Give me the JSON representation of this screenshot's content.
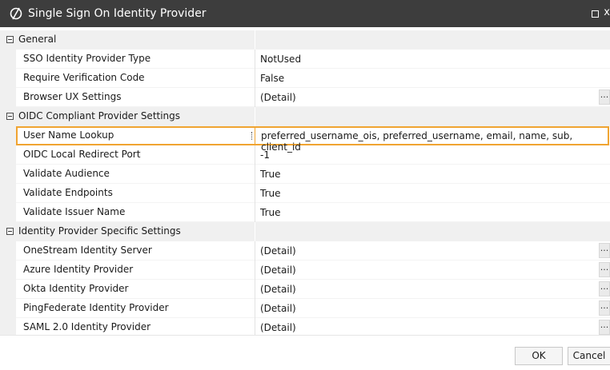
{
  "window": {
    "title": "Single Sign On Identity Provider",
    "close_glyph": "x"
  },
  "categories": [
    {
      "label": "General",
      "props": [
        {
          "name": "SSO Identity Provider Type",
          "value": "NotUsed",
          "ellipsis": false
        },
        {
          "name": "Require Verification Code",
          "value": "False",
          "ellipsis": false
        },
        {
          "name": "Browser UX Settings",
          "value": "(Detail)",
          "ellipsis": true
        }
      ]
    },
    {
      "label": "OIDC Compliant Provider Settings",
      "props": [
        {
          "name": "User Name Lookup",
          "value": "preferred_username_ois, preferred_username, email, name, sub, client_id",
          "ellipsis": false
        },
        {
          "name": "OIDC Local Redirect Port",
          "value": "-1",
          "ellipsis": false
        },
        {
          "name": "Validate Audience",
          "value": "True",
          "ellipsis": false
        },
        {
          "name": "Validate Endpoints",
          "value": "True",
          "ellipsis": false
        },
        {
          "name": "Validate Issuer Name",
          "value": "True",
          "ellipsis": false
        }
      ]
    },
    {
      "label": "Identity Provider Specific Settings",
      "props": [
        {
          "name": "OneStream Identity Server",
          "value": "(Detail)",
          "ellipsis": true
        },
        {
          "name": "Azure Identity Provider",
          "value": "(Detail)",
          "ellipsis": true
        },
        {
          "name": "Okta Identity Provider",
          "value": "(Detail)",
          "ellipsis": true
        },
        {
          "name": "PingFederate Identity Provider",
          "value": "(Detail)",
          "ellipsis": true
        },
        {
          "name": "SAML 2.0 Identity Provider",
          "value": "(Detail)",
          "ellipsis": true
        }
      ]
    }
  ],
  "ellipsis_label": "...",
  "buttons": {
    "ok": "OK",
    "cancel": "Cancel"
  },
  "colors": {
    "titlebar": "#3d3d3d",
    "selection_border": "#f0a431",
    "category_bg": "#f0f0f0"
  }
}
